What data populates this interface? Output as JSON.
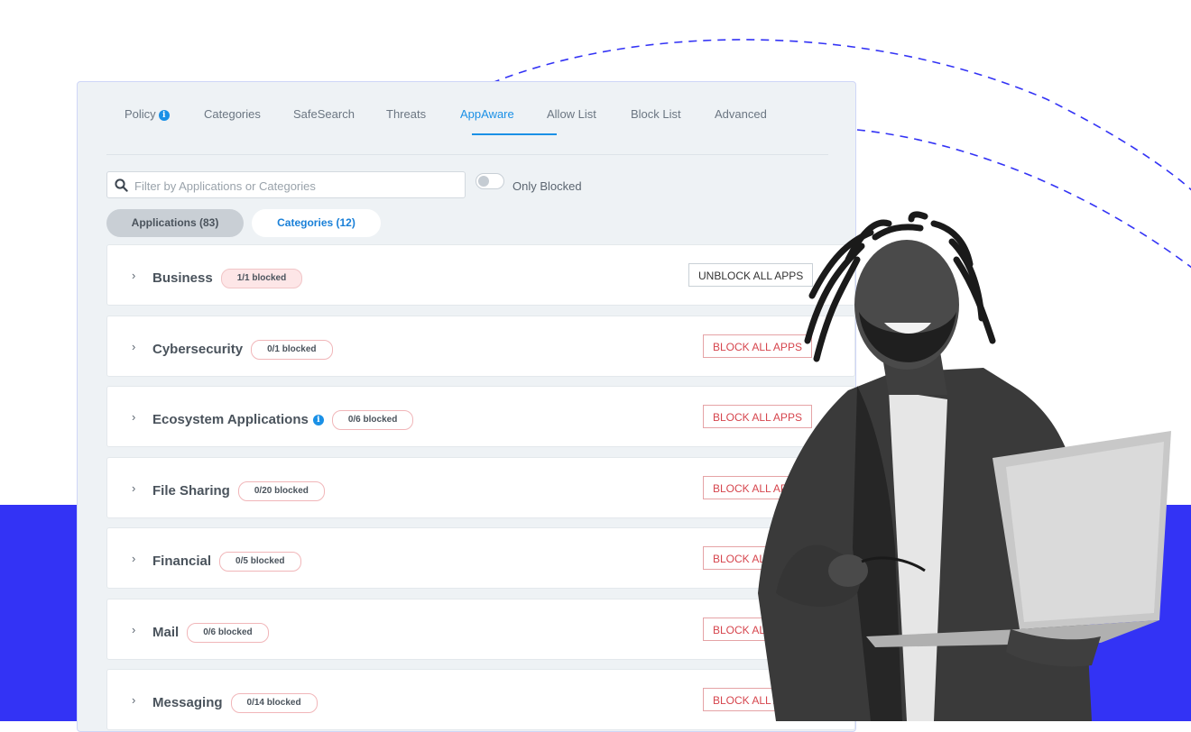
{
  "colors": {
    "accent_blue": "#1a90e6",
    "band_blue": "#3333f5",
    "block_red": "#d6454d",
    "badge_pink": "#fde6e7"
  },
  "tabs": [
    {
      "label": "Policy",
      "has_info_icon": true
    },
    {
      "label": "Categories"
    },
    {
      "label": "SafeSearch"
    },
    {
      "label": "Threats"
    },
    {
      "label": "AppAware",
      "active": true
    },
    {
      "label": "Allow List"
    },
    {
      "label": "Block List"
    },
    {
      "label": "Advanced"
    }
  ],
  "search": {
    "placeholder": "Filter by Applications or Categories",
    "value": "",
    "icon": "search-icon"
  },
  "toggle": {
    "label": "Only Blocked",
    "on": false
  },
  "segments": {
    "applications": "Applications (83)",
    "categories": "Categories (12)",
    "selected": "categories"
  },
  "categories": [
    {
      "name": "Business",
      "badge": "1/1 blocked",
      "button": "UNBLOCK ALL APPS"
    },
    {
      "name": "Cybersecurity",
      "badge": "0/1 blocked",
      "button": "BLOCK ALL APPS"
    },
    {
      "name": "Ecosystem Applications",
      "badge": "0/6 blocked",
      "button": "BLOCK ALL APPS",
      "has_info_icon": true
    },
    {
      "name": "File Sharing",
      "badge": "0/20 blocked",
      "button": "BLOCK ALL APPS"
    },
    {
      "name": "Financial",
      "badge": "0/5 blocked",
      "button": "BLOCK ALL APPS"
    },
    {
      "name": "Mail",
      "badge": "0/6 blocked",
      "button": "BLOCK ALL APPS"
    },
    {
      "name": "Messaging",
      "badge": "0/14 blocked",
      "button": "BLOCK ALL APPS"
    }
  ],
  "icons": {
    "expand": "chevron-right-icon",
    "info": "info-icon"
  },
  "glyphs": {
    "chevron": "›",
    "info": "i"
  }
}
